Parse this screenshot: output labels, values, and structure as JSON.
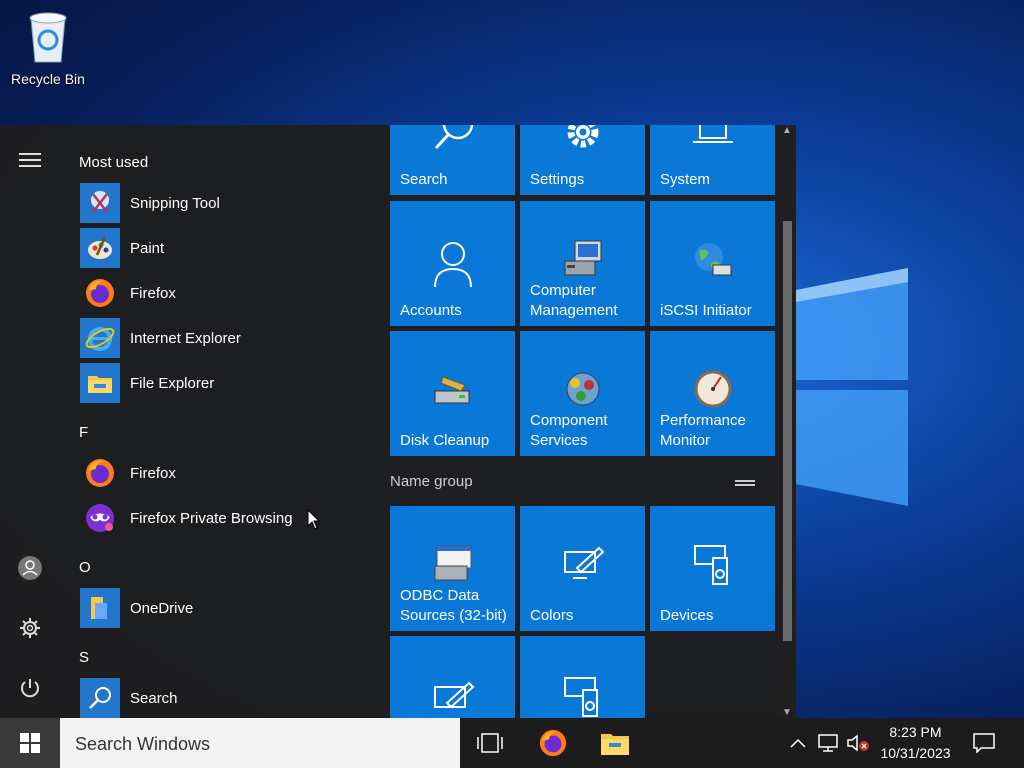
{
  "desktop": {
    "recycle_bin_label": "Recycle Bin"
  },
  "start_menu": {
    "most_used_header": "Most used",
    "most_used": [
      {
        "label": "Snipping Tool",
        "icon": "snipping-tool-icon"
      },
      {
        "label": "Paint",
        "icon": "paint-icon"
      },
      {
        "label": "Firefox",
        "icon": "firefox-icon"
      },
      {
        "label": "Internet Explorer",
        "icon": "internet-explorer-icon"
      },
      {
        "label": "File Explorer",
        "icon": "file-explorer-icon"
      }
    ],
    "section_f": "F",
    "f_apps": [
      {
        "label": "Firefox",
        "icon": "firefox-icon"
      },
      {
        "label": "Firefox Private Browsing",
        "icon": "firefox-private-icon"
      }
    ],
    "section_o": "O",
    "o_apps": [
      {
        "label": "OneDrive",
        "icon": "onedrive-icon"
      }
    ],
    "section_s": "S",
    "s_apps": [
      {
        "label": "Search",
        "icon": "search-icon"
      }
    ],
    "tiles_top": [
      {
        "label": "Search",
        "icon": "search-icon"
      },
      {
        "label": "Settings",
        "icon": "gear-icon"
      },
      {
        "label": "System",
        "icon": "laptop-icon"
      }
    ],
    "tiles_row2": [
      {
        "label": "Accounts",
        "icon": "person-icon"
      },
      {
        "label": "Computer Management",
        "icon": "computer-management-icon"
      },
      {
        "label": "iSCSI Initiator",
        "icon": "globe-icon"
      }
    ],
    "tiles_row3": [
      {
        "label": "Disk Cleanup",
        "icon": "disk-cleanup-icon"
      },
      {
        "label": "Component Services",
        "icon": "component-services-icon"
      },
      {
        "label": "Performance Monitor",
        "icon": "gauge-icon"
      }
    ],
    "group_name": "Name group",
    "tiles_group": [
      {
        "label": "ODBC Data Sources (32-bit)",
        "icon": "odbc-icon"
      },
      {
        "label": "Colors",
        "icon": "colors-icon"
      },
      {
        "label": "Devices",
        "icon": "devices-icon"
      }
    ]
  },
  "taskbar": {
    "search_placeholder": "Search Windows",
    "time": "8:23 PM",
    "date": "10/31/2023"
  },
  "colors": {
    "tile_blue": "#0a78d7",
    "start_bg": "#1e1e1e",
    "taskbar_bg": "#1c1c1c"
  }
}
